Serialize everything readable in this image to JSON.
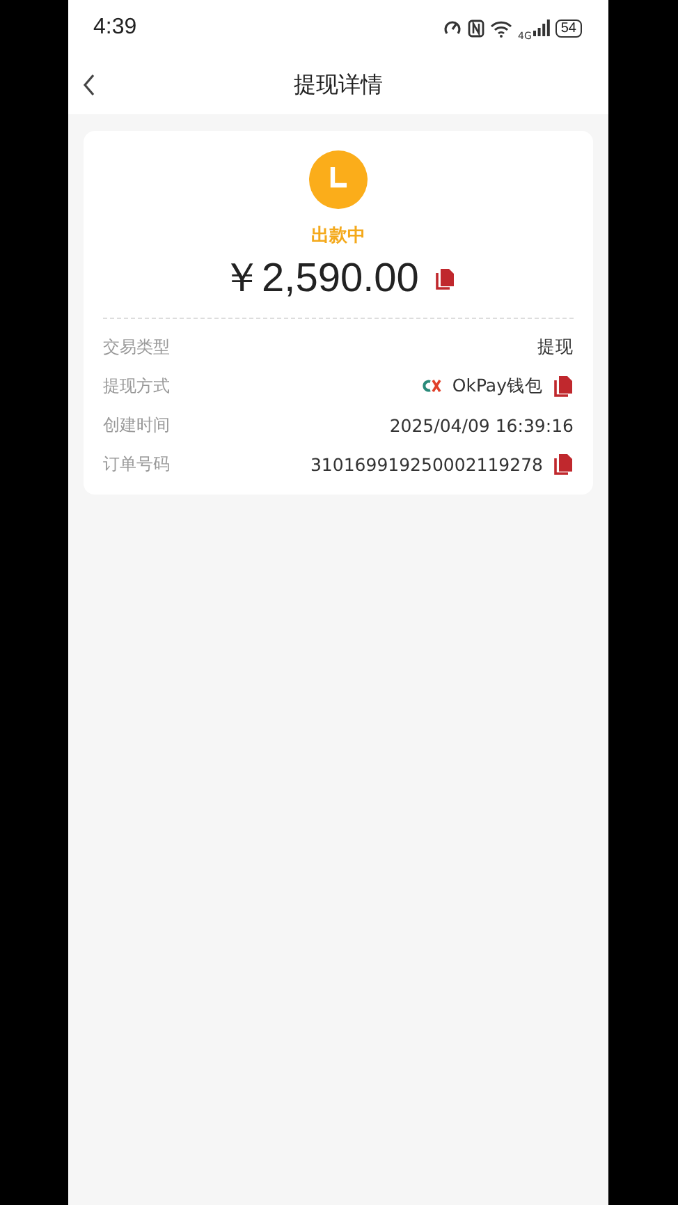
{
  "status_bar": {
    "time": "4:39",
    "network": "4G",
    "battery": "54"
  },
  "header": {
    "title": "提现详情"
  },
  "summary": {
    "status": "出款中",
    "amount": "￥2,590.00"
  },
  "details": [
    {
      "kind": "plain",
      "label": "交易类型",
      "value": "提现"
    },
    {
      "kind": "wallet",
      "label": "提现方式",
      "value": "OkPay钱包"
    },
    {
      "kind": "plain",
      "label": "创建时间",
      "value": "2025/04/09 16:39:16"
    },
    {
      "kind": "copy",
      "label": "订单号码",
      "value": "310169919250002119278"
    }
  ]
}
